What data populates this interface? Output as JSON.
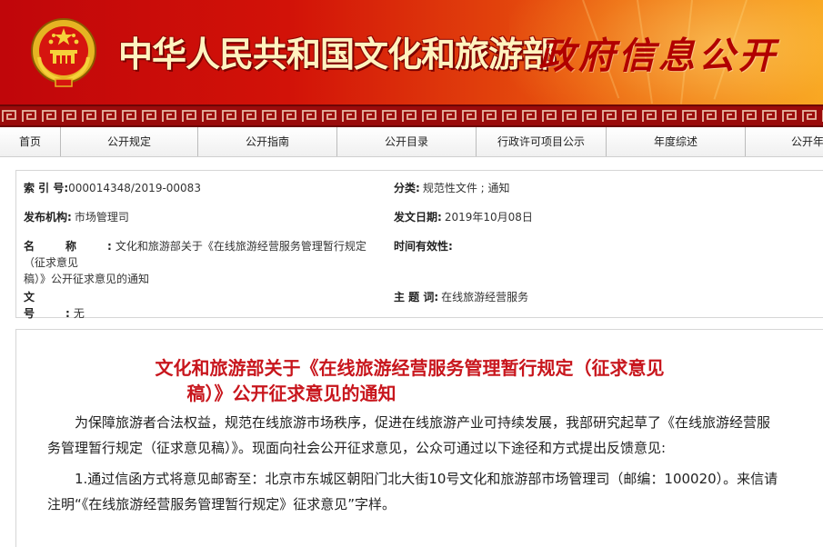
{
  "banner": {
    "site_title": "中华人民共和国文化和旅游部",
    "subtitle": "政府信息公开",
    "colors": {
      "red": "#c0060a",
      "orange": "#f7a21c",
      "title_text": "#fff3c0",
      "subtitle_text": "#b10000"
    }
  },
  "nav": {
    "items": [
      "首页",
      "公开规定",
      "公开指南",
      "公开目录",
      "行政许可项目公示",
      "年度综述",
      "公开年报"
    ]
  },
  "info": {
    "index_label": "索 引 号:",
    "index_value": "000014348/2019-00083",
    "category_label": "分类:",
    "category_value": "规范性文件 ; 通知",
    "publisher_label": "发布机构:",
    "publisher_value": "市场管理司",
    "date_label": "发文日期:",
    "date_value": "2019年10月08日",
    "name_label": "名称:",
    "name_value_line1": "文化和旅游部关于《在线旅游经营服务管理暂行规定（征求意见",
    "name_value_line2": "稿）》公开征求意见的通知",
    "validity_label": "时间有效性:",
    "validity_value": "",
    "docno_label": "文号:",
    "docno_value": "无",
    "subject_label": "主 题 词:",
    "subject_value": "在线旅游经营服务"
  },
  "article": {
    "title_line1": "文化和旅游部关于《在线旅游经营服务管理暂行规定（征求意见",
    "title_line2": "稿）》公开征求意见的通知",
    "p1_line1": "为保障旅游者合法权益，规范在线旅游市场秩序，促进在线旅游产业可持续发展，我部研究起草了《在线旅游经营服",
    "p1_line2": "务管理暂行规定（征求意见稿）》。现面向社会公开征求意见，公众可通过以下途径和方式提出反馈意见:",
    "p2_line1": "1.通过信函方式将意见邮寄至：北京市东城区朝阳门北大街10号文化和旅游部市场管理司（邮编：100020）。来信请",
    "p2_line2": "注明“《在线旅游经营服务管理暂行规定》征求意见”字样。"
  }
}
